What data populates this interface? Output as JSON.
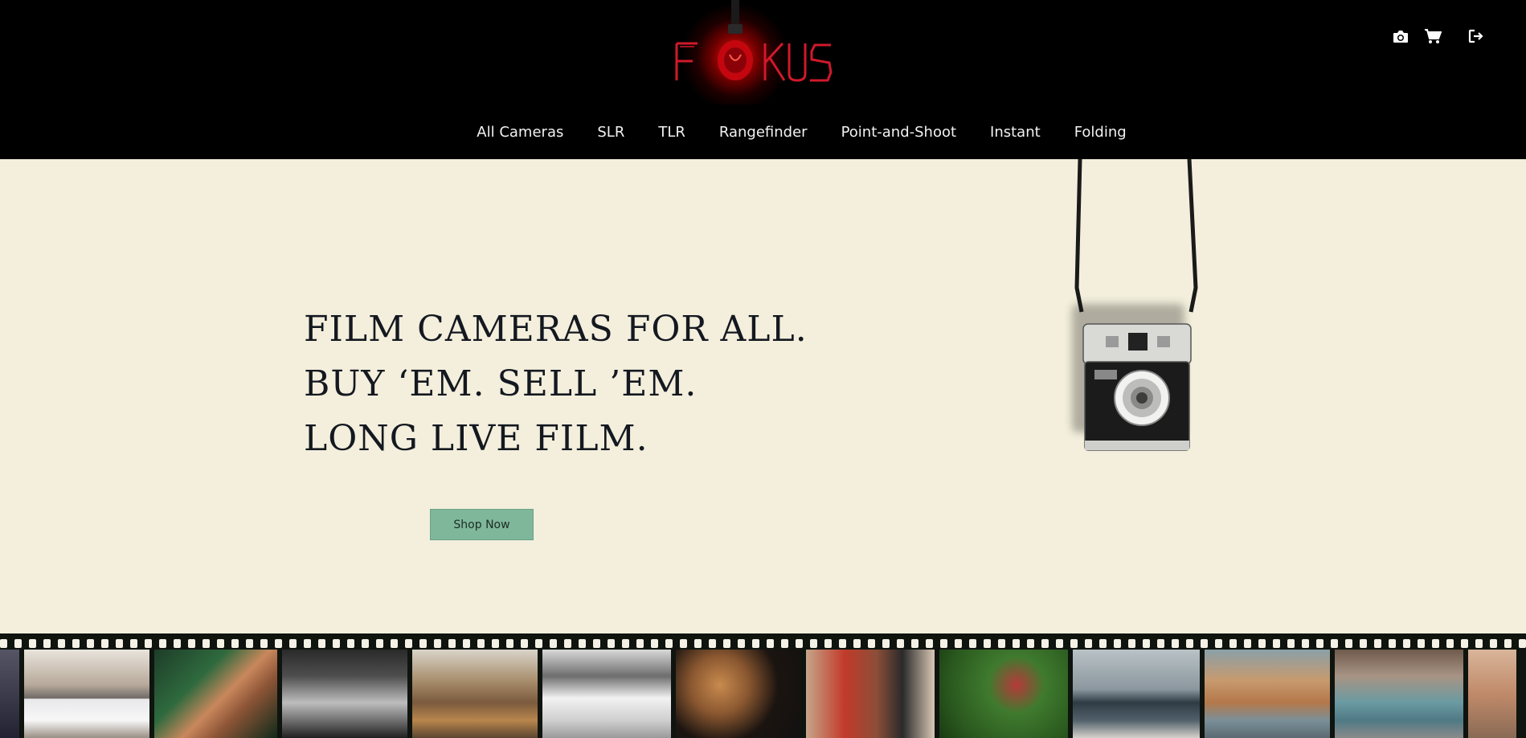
{
  "brand": {
    "logo_text": "FOKUS"
  },
  "header_icons": [
    {
      "name": "camera-icon"
    },
    {
      "name": "cart-icon"
    },
    {
      "name": "sign-out-icon"
    }
  ],
  "nav": {
    "items": [
      "All Cameras",
      "SLR",
      "TLR",
      "Rangefinder",
      "Point-and-Shoot",
      "Instant",
      "Folding"
    ]
  },
  "hero": {
    "lines": [
      "FILM CAMERAS FOR ALL.",
      "BUY ‘EM. SELL ’EM.",
      "LONG LIVE FILM."
    ],
    "cta_label": "Shop Now"
  },
  "colors": {
    "header_bg": "#000000",
    "page_bg": "#f3efdc",
    "cta_bg": "#7fb79b",
    "logo_red": "#d1192a",
    "film_bg": "#0f140f"
  }
}
